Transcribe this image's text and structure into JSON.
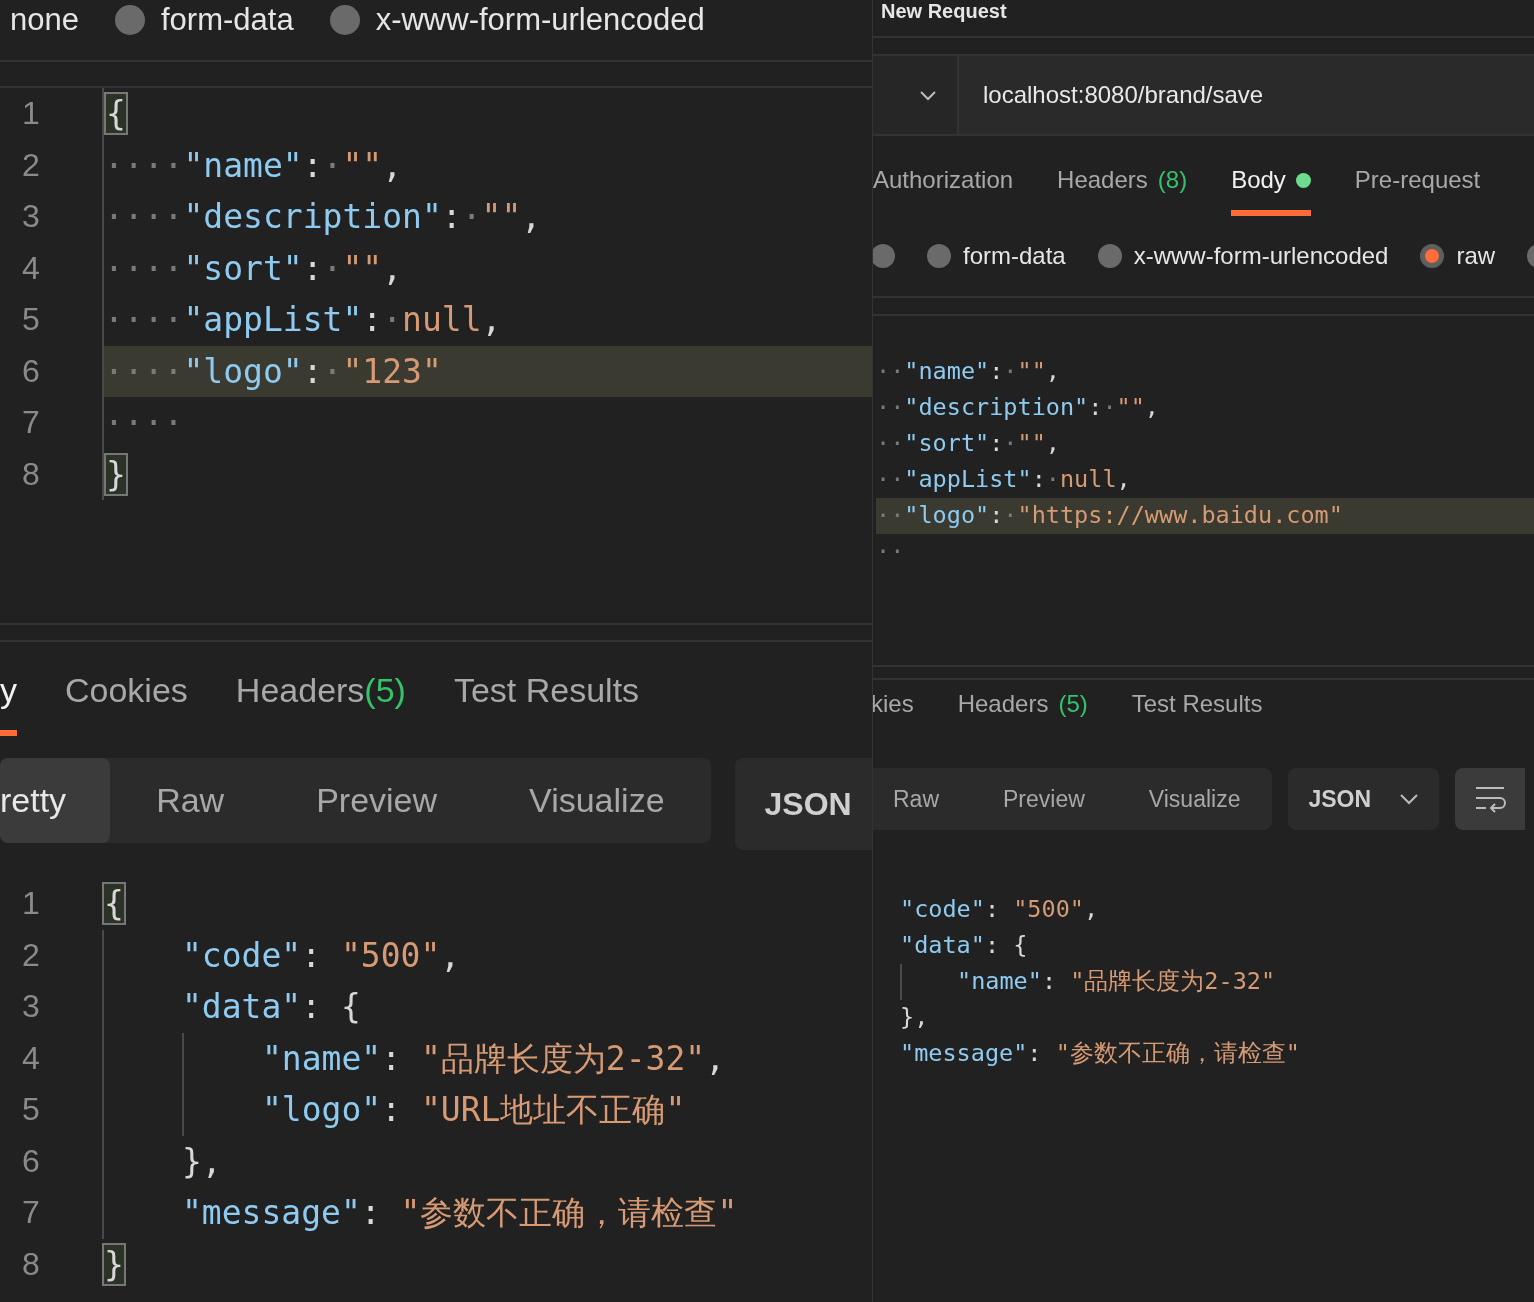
{
  "left_pane": {
    "body_types": [
      {
        "label": "none",
        "kind": "text"
      },
      {
        "label": "form-data",
        "kind": "radio",
        "selected": false
      },
      {
        "label": "x-www-form-urlencoded",
        "kind": "radio",
        "selected": false
      }
    ],
    "request_editor": {
      "lines": [
        {
          "number": "1",
          "highlighted": false,
          "tokens": [
            {
              "kind": "bracket_match",
              "text": "{"
            }
          ]
        },
        {
          "number": "2",
          "highlighted": false,
          "tokens": [
            {
              "kind": "ws",
              "text": "····"
            },
            {
              "kind": "key",
              "text": "\"name\""
            },
            {
              "kind": "punc",
              "text": ":"
            },
            {
              "kind": "ws",
              "text": "·"
            },
            {
              "kind": "str",
              "text": "\"\""
            },
            {
              "kind": "punc",
              "text": ","
            }
          ]
        },
        {
          "number": "3",
          "highlighted": false,
          "tokens": [
            {
              "kind": "ws",
              "text": "····"
            },
            {
              "kind": "key",
              "text": "\"description\""
            },
            {
              "kind": "punc",
              "text": ":"
            },
            {
              "kind": "ws",
              "text": "·"
            },
            {
              "kind": "str",
              "text": "\"\""
            },
            {
              "kind": "punc",
              "text": ","
            }
          ]
        },
        {
          "number": "4",
          "highlighted": false,
          "tokens": [
            {
              "kind": "ws",
              "text": "····"
            },
            {
              "kind": "key",
              "text": "\"sort\""
            },
            {
              "kind": "punc",
              "text": ":"
            },
            {
              "kind": "ws",
              "text": "·"
            },
            {
              "kind": "str",
              "text": "\"\""
            },
            {
              "kind": "punc",
              "text": ","
            }
          ]
        },
        {
          "number": "5",
          "highlighted": false,
          "tokens": [
            {
              "kind": "ws",
              "text": "····"
            },
            {
              "kind": "key",
              "text": "\"appList\""
            },
            {
              "kind": "punc",
              "text": ":"
            },
            {
              "kind": "ws",
              "text": "·"
            },
            {
              "kind": "lit",
              "text": "null"
            },
            {
              "kind": "punc",
              "text": ","
            }
          ]
        },
        {
          "number": "6",
          "highlighted": true,
          "tokens": [
            {
              "kind": "ws",
              "text": "····"
            },
            {
              "kind": "key",
              "text": "\"logo\""
            },
            {
              "kind": "punc",
              "text": ":"
            },
            {
              "kind": "ws",
              "text": "·"
            },
            {
              "kind": "str",
              "text": "\"123\""
            }
          ]
        },
        {
          "number": "7",
          "highlighted": false,
          "tokens": [
            {
              "kind": "ws",
              "text": "····"
            }
          ]
        },
        {
          "number": "8",
          "highlighted": false,
          "tokens": [
            {
              "kind": "bracket_match",
              "text": "}"
            }
          ]
        }
      ]
    },
    "response_tabs": [
      {
        "label": "y",
        "selected": true
      },
      {
        "label": "Cookies",
        "selected": false
      },
      {
        "label": "Headers",
        "count": "(5)",
        "selected": false
      },
      {
        "label": "Test Results",
        "selected": false
      }
    ],
    "view_modes": [
      {
        "label": "retty",
        "selected": true
      },
      {
        "label": "Raw",
        "selected": false
      },
      {
        "label": "Preview",
        "selected": false
      },
      {
        "label": "Visualize",
        "selected": false
      }
    ],
    "format_dropdown": {
      "label": "JSON"
    },
    "response_editor": {
      "lines": [
        {
          "number": "1",
          "tokens": [
            {
              "kind": "bracket_match",
              "text": "{"
            }
          ],
          "children": [
            {
              "number": "2",
              "tokens": [
                {
                  "kind": "key",
                  "text": "\"code\""
                },
                {
                  "kind": "punc",
                  "text": ": "
                },
                {
                  "kind": "str",
                  "text": "\"500\""
                },
                {
                  "kind": "punc",
                  "text": ","
                }
              ]
            },
            {
              "number": "3",
              "tokens": [
                {
                  "kind": "key",
                  "text": "\"data\""
                },
                {
                  "kind": "punc",
                  "text": ": {"
                }
              ],
              "children": [
                {
                  "number": "4",
                  "tokens": [
                    {
                      "kind": "key",
                      "text": "\"name\""
                    },
                    {
                      "kind": "punc",
                      "text": ": "
                    },
                    {
                      "kind": "str",
                      "text": "\"品牌长度为2-32\""
                    },
                    {
                      "kind": "punc",
                      "text": ","
                    }
                  ]
                },
                {
                  "number": "5",
                  "tokens": [
                    {
                      "kind": "key",
                      "text": "\"logo\""
                    },
                    {
                      "kind": "punc",
                      "text": ": "
                    },
                    {
                      "kind": "str",
                      "text": "\"URL地址不正确\""
                    }
                  ]
                }
              ]
            },
            {
              "number": "6",
              "tokens": [
                {
                  "kind": "punc",
                  "text": "},"
                }
              ]
            },
            {
              "number": "7",
              "tokens": [
                {
                  "kind": "key",
                  "text": "\"message\""
                },
                {
                  "kind": "punc",
                  "text": ": "
                },
                {
                  "kind": "str",
                  "text": "\"参数不正确，请检查\""
                }
              ]
            }
          ]
        },
        {
          "number": "8",
          "tokens": [
            {
              "kind": "bracket_match",
              "text": "}"
            }
          ]
        }
      ]
    }
  },
  "right_pane": {
    "title": "New Request",
    "url": "localhost:8080/brand/save",
    "request_tabs": [
      {
        "label": "Authorization",
        "selected": false
      },
      {
        "label": "Headers",
        "count": "(8)",
        "selected": false
      },
      {
        "label": "Body",
        "selected": true,
        "modified": true
      },
      {
        "label": "Pre-request",
        "selected": false
      }
    ],
    "body_types": [
      {
        "kind": "radio",
        "selected": false
      },
      {
        "label": "form-data",
        "kind": "radio",
        "selected": false
      },
      {
        "label": "x-www-form-urlencoded",
        "kind": "radio",
        "selected": false
      },
      {
        "label": "raw",
        "kind": "radio",
        "selected": true
      },
      {
        "kind": "radio",
        "selected": false
      }
    ],
    "request_editor": {
      "lines": [
        {
          "highlighted": false,
          "tokens": [
            {
              "kind": "ws",
              "text": "··"
            },
            {
              "kind": "key",
              "text": "\"name\""
            },
            {
              "kind": "punc",
              "text": ":"
            },
            {
              "kind": "ws",
              "text": "·"
            },
            {
              "kind": "str",
              "text": "\"\""
            },
            {
              "kind": "punc",
              "text": ","
            }
          ]
        },
        {
          "highlighted": false,
          "tokens": [
            {
              "kind": "ws",
              "text": "··"
            },
            {
              "kind": "key",
              "text": "\"description\""
            },
            {
              "kind": "punc",
              "text": ":"
            },
            {
              "kind": "ws",
              "text": "·"
            },
            {
              "kind": "str",
              "text": "\"\""
            },
            {
              "kind": "punc",
              "text": ","
            }
          ]
        },
        {
          "highlighted": false,
          "tokens": [
            {
              "kind": "ws",
              "text": "··"
            },
            {
              "kind": "key",
              "text": "\"sort\""
            },
            {
              "kind": "punc",
              "text": ":"
            },
            {
              "kind": "ws",
              "text": "·"
            },
            {
              "kind": "str",
              "text": "\"\""
            },
            {
              "kind": "punc",
              "text": ","
            }
          ]
        },
        {
          "highlighted": false,
          "tokens": [
            {
              "kind": "ws",
              "text": "··"
            },
            {
              "kind": "key",
              "text": "\"appList\""
            },
            {
              "kind": "punc",
              "text": ":"
            },
            {
              "kind": "ws",
              "text": "·"
            },
            {
              "kind": "lit",
              "text": "null"
            },
            {
              "kind": "punc",
              "text": ","
            }
          ]
        },
        {
          "highlighted": true,
          "tokens": [
            {
              "kind": "ws",
              "text": "··"
            },
            {
              "kind": "key",
              "text": "\"logo\""
            },
            {
              "kind": "punc",
              "text": ":"
            },
            {
              "kind": "ws",
              "text": "·"
            },
            {
              "kind": "str",
              "text": "\"https://www.baidu.com\""
            }
          ]
        },
        {
          "highlighted": false,
          "tokens": [
            {
              "kind": "ws",
              "text": "··"
            }
          ]
        }
      ]
    },
    "response_tabs": [
      {
        "label": "kies",
        "selected": false
      },
      {
        "label": "Headers",
        "count": "(5)",
        "selected": false
      },
      {
        "label": "Test Results",
        "selected": false
      }
    ],
    "view_modes": [
      {
        "label": "Raw",
        "selected": false
      },
      {
        "label": "Preview",
        "selected": false
      },
      {
        "label": "Visualize",
        "selected": false
      }
    ],
    "format_dropdown": {
      "label": "JSON"
    },
    "response_editor": {
      "lines": [
        {
          "tokens": [
            {
              "kind": "key",
              "text": "\"code\""
            },
            {
              "kind": "punc",
              "text": ": "
            },
            {
              "kind": "str",
              "text": "\"500\""
            },
            {
              "kind": "punc",
              "text": ","
            }
          ]
        },
        {
          "tokens": [
            {
              "kind": "key",
              "text": "\"data\""
            },
            {
              "kind": "punc",
              "text": ": {"
            }
          ],
          "children": [
            {
              "tokens": [
                {
                  "kind": "key",
                  "text": "\"name\""
                },
                {
                  "kind": "punc",
                  "text": ": "
                },
                {
                  "kind": "str",
                  "text": "\"品牌长度为2-32\""
                }
              ]
            }
          ]
        },
        {
          "tokens": [
            {
              "kind": "punc",
              "text": "},"
            }
          ]
        },
        {
          "tokens": [
            {
              "kind": "key",
              "text": "\"message\""
            },
            {
              "kind": "punc",
              "text": ": "
            },
            {
              "kind": "str",
              "text": "\"参数不正确，请检查\""
            }
          ]
        }
      ]
    }
  }
}
